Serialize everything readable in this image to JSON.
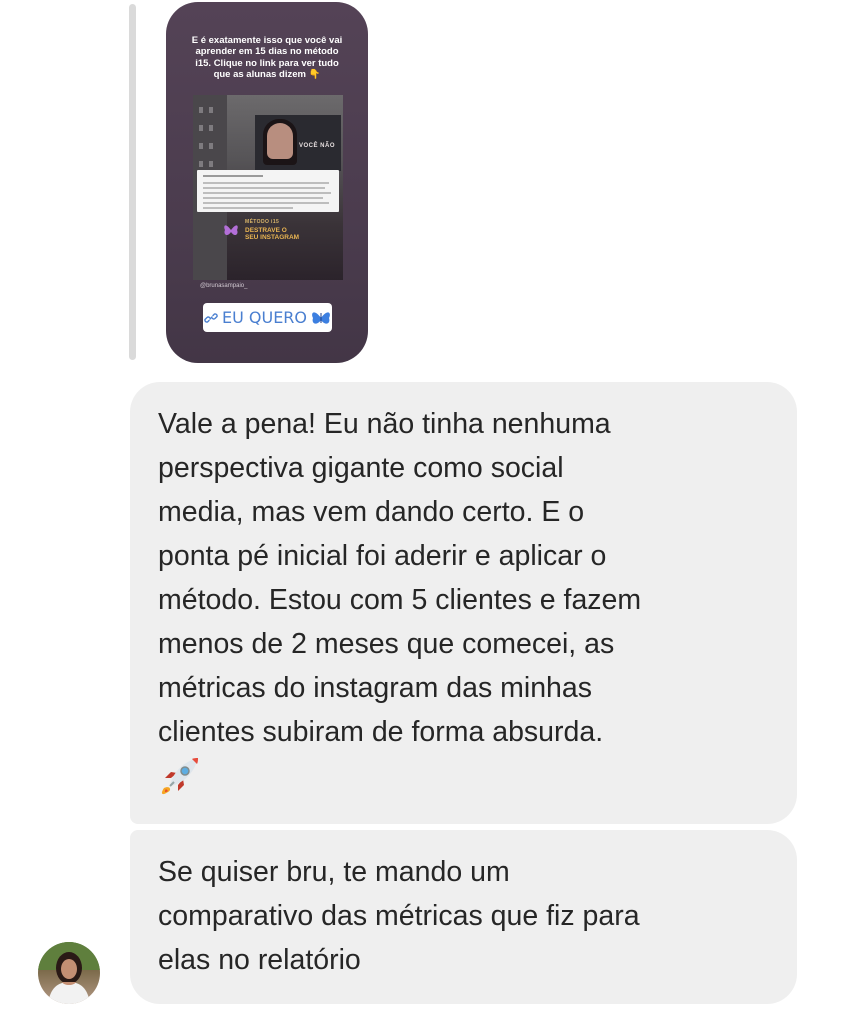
{
  "story": {
    "caption_lines": [
      "E é exatamente isso que você vai",
      "aprender em 15 dias no método",
      "i15. Clique no link para ver tudo",
      "que as alunas dizem 👇"
    ],
    "billboard_text": "VOCÊ NÃO",
    "brand_small": "MÉTODO i15",
    "brand_big_lines": [
      "DESTRAVE O",
      "SEU INSTAGRAM"
    ],
    "handle": "@brunasampaio_",
    "link_label": "EU QUERO"
  },
  "messages": [
    {
      "lines": [
        "Vale a pena! Eu não tinha nenhuma",
        "perspectiva gigante como social",
        "media, mas vem dando certo. E o",
        "ponta pé inicial foi aderir e aplicar o",
        "método. Estou com 5 clientes e fazem",
        "menos de 2 meses que comecei, as",
        "métricas do instagram das minhas",
        "clientes subiram de forma absurda."
      ],
      "emoji": "rocket-emoji"
    },
    {
      "lines": [
        "Se quiser bru, te mando um",
        "comparativo das métricas que fiz para",
        "elas no relatório"
      ]
    }
  ],
  "colors": {
    "bubble": "#efefef",
    "story_bg": "#4b3c4e",
    "link_blue": "#4a7fd0"
  }
}
